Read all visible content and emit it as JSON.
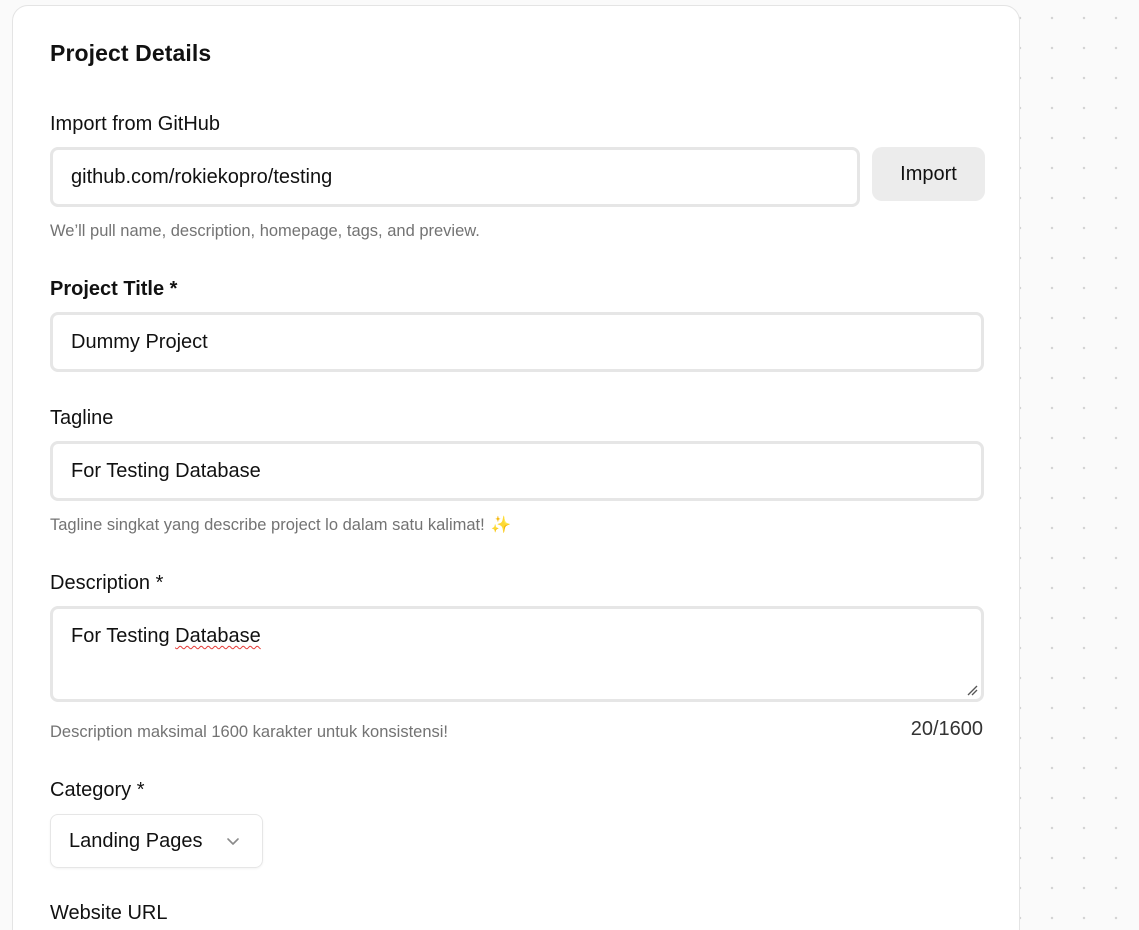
{
  "form": {
    "title": "Project Details",
    "github": {
      "label": "Import from GitHub",
      "value": "github.com/rokiekopro/testing",
      "button": "Import",
      "help": "We’ll pull name, description, homepage, tags, and preview."
    },
    "project_title": {
      "label": "Project Title *",
      "value": "Dummy Project"
    },
    "tagline": {
      "label": "Tagline",
      "value": "For Testing Database",
      "help": "Tagline singkat yang describe project lo dalam satu kalimat!",
      "help_emoji": "✨"
    },
    "description": {
      "label": "Description *",
      "value_prefix": "For Testing ",
      "value_misspelled": "Database",
      "help": "Description maksimal 1600 karakter untuk konsistensi!",
      "counter": "20/1600"
    },
    "category": {
      "label": "Category *",
      "selected": "Landing Pages"
    },
    "website_url": {
      "label": "Website URL"
    }
  },
  "icons": {
    "category_dropdown": "chevron-down-icon",
    "textarea_resize": "resize-handle-icon",
    "tagline_emoji": "sparkles-icon"
  },
  "colors": {
    "card_bg": "#ffffff",
    "page_bg": "#fafafa",
    "button_bg": "#ececec",
    "field_border": "#e6e6e6",
    "help_text": "#737373",
    "spellcheck": "#e53935"
  }
}
